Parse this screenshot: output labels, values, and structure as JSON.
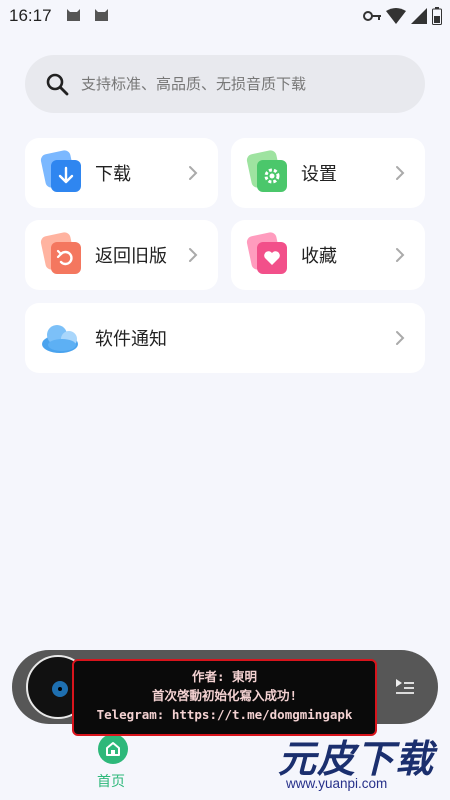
{
  "status_bar": {
    "time": "16:17"
  },
  "search": {
    "placeholder": "支持标准、高品质、无损音质下载"
  },
  "menu": {
    "download": "下载",
    "settings": "设置",
    "back_old": "返回旧版",
    "favorites": "收藏",
    "notice": "软件通知"
  },
  "toast": {
    "line1": "作者: 東明",
    "line2": "首次啓動初始化寫入成功!",
    "line3": "Telegram: https://t.me/domgmingapk"
  },
  "bottom_nav": {
    "home_label": "首页"
  },
  "watermark": {
    "title": "元皮下载",
    "url": "www.yuanpi.com"
  }
}
